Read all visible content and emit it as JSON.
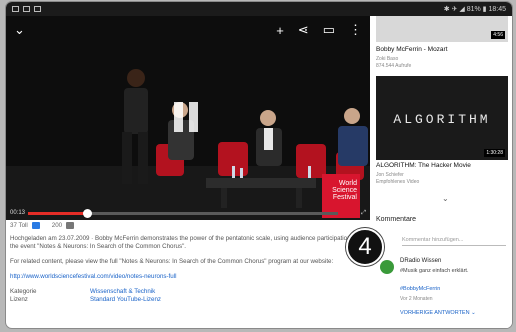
{
  "statusbar": {
    "right": "✱ ✈ ◢ 81% ▮ 18:45"
  },
  "player": {
    "elapsed": "00:13",
    "festival_badge": "World Science Festival",
    "progress_fraction": 0.19
  },
  "info": {
    "likes": "37 Toll",
    "dislikes": "200",
    "paragraph1": "Hochgeladen am 23.07.2009 · Bobby McFerrin demonstrates the power of the pentatonic scale, using audience participation, at the event \"Notes & Neurons: In Search of the Common Chorus\".",
    "paragraph2": "For related content, please view the full \"Notes & Neurons: In Search of the Common Chorus\" program at our website:",
    "link": "http://www.worldsciencefestival.com/video/notes-neurons-full",
    "meta": [
      {
        "key": "Kategorie",
        "value": "Wissenschaft & Technik"
      },
      {
        "key": "Lizenz",
        "value": "Standard YouTube-Lizenz"
      }
    ]
  },
  "sidebar": {
    "rel1": {
      "title": "Bobby McFerrin - Mozart",
      "channel": "Zoki Baso",
      "views": "874.544 Aufrufe",
      "duration": "4:56"
    },
    "rel2": {
      "thumb_text": "ALGORITHM",
      "title": "ALGORITHM: The Hacker Movie",
      "channel": "Jon Schiefer",
      "views": "Empfohlenes Video",
      "duration": "1:30:28"
    },
    "comments_header": "Kommentare",
    "comment_placeholder": "Kommentar hinzufügen...",
    "badge_number": "4",
    "comment": {
      "author": "DRadio Wissen",
      "text": "#Musik ganz einfach erklärt.",
      "tag": "#BobbyMcFerrin",
      "time": "Vor 2 Monaten",
      "prev_answers": "VORHERIGE ANTWORTEN ⌄"
    }
  }
}
